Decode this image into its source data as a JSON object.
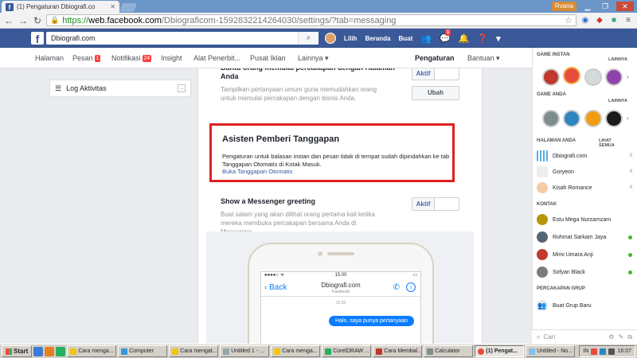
{
  "browser": {
    "tab_title": "(1) Pengaturan Dbiografi.co",
    "url_scheme": "https://",
    "url_host": "web.facebook.com",
    "url_path": "/Dbiograficom-1592832214264030/settings/?tab=messaging",
    "user_label": "Rvana"
  },
  "fb": {
    "search_value": "Dbiografi.com",
    "user_name": "Lilih",
    "home": "Beranda",
    "create": "Buat",
    "message_badge": "1"
  },
  "page_nav": {
    "halaman": "Halaman",
    "pesan": "Pesan",
    "pesan_count": "1",
    "notifikasi": "Notifikasi",
    "notifikasi_count": "24",
    "insight": "Insight",
    "alat": "Alat Penerbit...",
    "pusat": "Pusat Iklan",
    "lainnya": "Lainnya ▾",
    "pengaturan": "Pengaturan",
    "bantuan": "Bantuan ▾"
  },
  "left": {
    "log": "Log Aktivitas"
  },
  "settings": {
    "top_partial": "Bantu orang memulai percakapan dengan Halaman Anda",
    "top_desc": "Tampilkan pertanyaan umum guna memudahkan orang untuk memulai percakapan dengan bisnis Anda.",
    "top_toggle": "Aktif",
    "edit_btn": "Ubah",
    "assist_title": "Asisten Pemberi Tanggapan",
    "assist_desc": "Pengaturan untuk balasan instan dan pesan tidak di tempat sudah dipindahkan ke tab Tanggapan Otomatis di Kotak Masuk.",
    "assist_link": "Buka Tanggapan Otomatis",
    "greet_title": "Show a Messenger greeting",
    "greet_desc": "Buat salam yang akan dilihat orang pertama kali ketika mereka membuka percakapan bersama Anda di Messenger.",
    "greet_toggle": "Aktif"
  },
  "phone": {
    "status_time": "15.00",
    "back": "‹ Back",
    "name": "Dbiografi.com",
    "sub": "Facebook",
    "time": "15.00",
    "bubble": "Halo, saya punya pertanyaan"
  },
  "sidebar": {
    "game_instan": "GAME INSTAN",
    "game_anda": "GAME ANDA",
    "lainnya": "LAINNYA",
    "halaman_anda": "HALAMAN ANDA",
    "lihat_semua": "LIHAT SEMUA",
    "pages": [
      {
        "name": "Dbiografi.com",
        "count": "9"
      },
      {
        "name": "Goryeon",
        "count": "9"
      },
      {
        "name": "Kisah Romance",
        "count": "9"
      }
    ],
    "kontak": "KONTAK",
    "contacts": [
      "Estu Mega Nurzamzam",
      "Rohmat Sarkam Jaya",
      "Mimi Umara Anji",
      "Sofyan Black"
    ],
    "grup_header": "PERCAKAPAN GRUP",
    "grup_new": "Buat Grup Baru",
    "chat_search": "Cari"
  },
  "taskbar": {
    "start": "Start",
    "tasks": [
      "Cara menga...",
      "Computer",
      "Cara mengat...",
      "Untitled 1 - ...",
      "Cara menga...",
      "CorelDRAW ...",
      "Cara Membal...",
      "Calculator",
      "(1) Pengat...",
      "Untitled - No..."
    ],
    "lang": "IN",
    "clock": "16:07"
  },
  "colors": {
    "fb_blue": "#3b5998",
    "highlight_red": "#e02020",
    "badge_red": "#fa3e3e",
    "messenger_blue": "#0a7cff"
  }
}
